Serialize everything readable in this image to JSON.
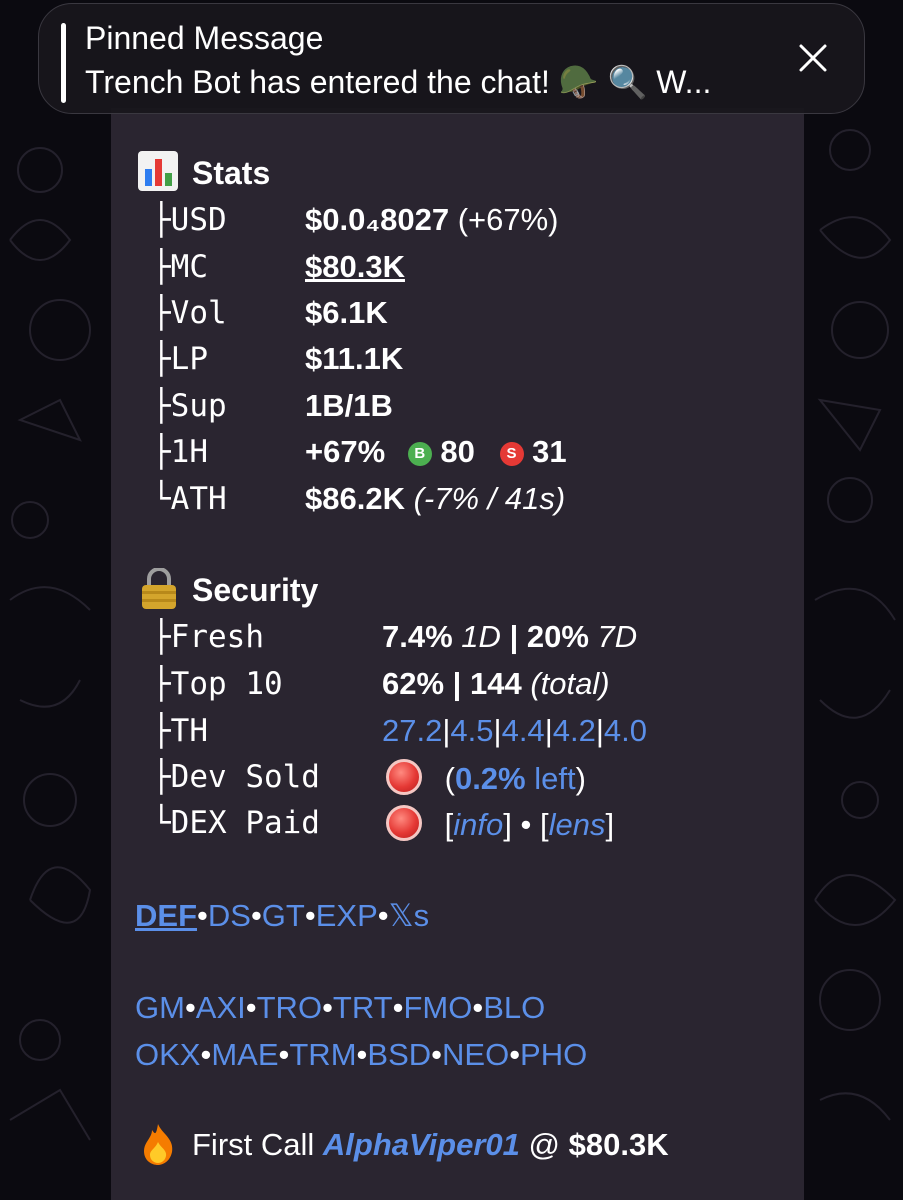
{
  "pinned": {
    "title": "Pinned Message",
    "text": "Trench Bot has entered the chat! 🪖 🔍 W..."
  },
  "stats": {
    "title": "Stats",
    "rows": [
      {
        "key": "├USD",
        "value": "$0.0₄8027",
        "extra": "(+67%)"
      },
      {
        "key": "├MC",
        "value": "$80.3K"
      },
      {
        "key": "├Vol",
        "value": "$6.1K"
      },
      {
        "key": "├LP",
        "value": "$11.1K"
      },
      {
        "key": "├Sup",
        "value": "1B/1B"
      },
      {
        "key": "├1H",
        "value": "+67%",
        "buy_badge": "B",
        "buys": "80",
        "sell_badge": "S",
        "sells": "31"
      },
      {
        "key": "└ATH",
        "value": "$86.2K",
        "extra": "(-7% / 41s)"
      }
    ]
  },
  "security": {
    "title": "Security",
    "fresh": {
      "key": "├Fresh",
      "v1": "7.4%",
      "l1": "1D",
      "sep": "|",
      "v2": "20%",
      "l2": "7D"
    },
    "top10": {
      "key": "├Top 10",
      "v1": "62%",
      "sep": "|",
      "v2": "144",
      "l2": "(total)"
    },
    "th": {
      "key": "├TH",
      "values": [
        "27.2",
        "4.5",
        "4.4",
        "4.2",
        "4.0"
      ],
      "sep": "|"
    },
    "dev_sold": {
      "key": "├Dev Sold",
      "open": "(",
      "link": "0.2%",
      "after": " left",
      "close": ")"
    },
    "dex_paid": {
      "key": "└DEX Paid",
      "b1": "[",
      "info": "info",
      "b2": "]",
      "dot": "•",
      "b3": "[",
      "lens": "lens",
      "b4": "]"
    }
  },
  "links_row1": [
    "DEF",
    "DS",
    "GT",
    "EXP",
    "𝕏s"
  ],
  "links_row2": [
    "GM",
    "AXI",
    "TRO",
    "TRT",
    "FMO",
    "BLO"
  ],
  "links_row3": [
    "OKX",
    "MAE",
    "TRM",
    "BSD",
    "NEO",
    "PHO"
  ],
  "link_separator": "•",
  "first_call": {
    "label": "First Call",
    "user": "AlphaViper01",
    "at": "@",
    "value": "$80.3K"
  },
  "colors": {
    "link": "#5b8fe8",
    "bubble": "#2a2530",
    "buy": "#4caf50",
    "sell": "#e53935"
  },
  "icons": {
    "close": "close-icon",
    "stats": "bar-chart-icon",
    "security": "lock-icon",
    "fire": "fire-icon"
  }
}
